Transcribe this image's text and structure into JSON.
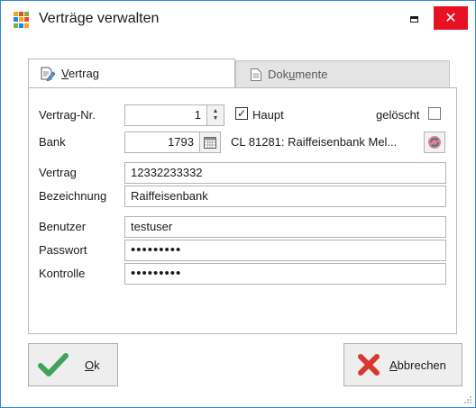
{
  "window": {
    "title": "Verträge verwalten",
    "close_label": "✕"
  },
  "tabs": [
    {
      "label": "Vertrag",
      "mnemonic": "V",
      "rest": "ertrag",
      "active": true
    },
    {
      "label": "Dokumente",
      "pre": "Dok",
      "mnemonic": "u",
      "rest": "mente",
      "active": false
    }
  ],
  "form": {
    "vertrag_nr": {
      "label": "Vertrag-Nr.",
      "value": "1"
    },
    "haupt": {
      "label": "Haupt",
      "checked": true
    },
    "geloescht": {
      "label": "gelöscht",
      "checked": false
    },
    "bank": {
      "label": "Bank",
      "value": "1793",
      "info": "CL 81281: Raiffeisenbank Mel..."
    },
    "vertrag": {
      "label": "Vertrag",
      "value": "12332233332"
    },
    "bezeichnung": {
      "label": "Bezeichnung",
      "value": "Raiffeisenbank"
    },
    "benutzer": {
      "label": "Benutzer",
      "value": "testuser"
    },
    "passwort": {
      "label": "Passwort",
      "value": "•••••••••"
    },
    "kontrolle": {
      "label": "Kontrolle",
      "value": "•••••••••"
    }
  },
  "buttons": {
    "ok": {
      "label": "Ok",
      "mnemonic": "O",
      "rest": "k"
    },
    "cancel": {
      "label": "Abbrechen",
      "mnemonic": "A",
      "rest": "bbrechen"
    }
  },
  "colors": {
    "accent_border": "#2b88d8",
    "close_red": "#e81123",
    "ok_green": "#3fa35c",
    "cancel_red": "#d9372f"
  },
  "icons": {
    "app": "colored-grid-icon",
    "tab_vertrag": "edit-document-icon",
    "tab_dokumente": "document-icon",
    "calendar": "calendar-icon",
    "refresh": "refresh-icon",
    "ok": "checkmark-icon",
    "cancel": "x-icon"
  }
}
